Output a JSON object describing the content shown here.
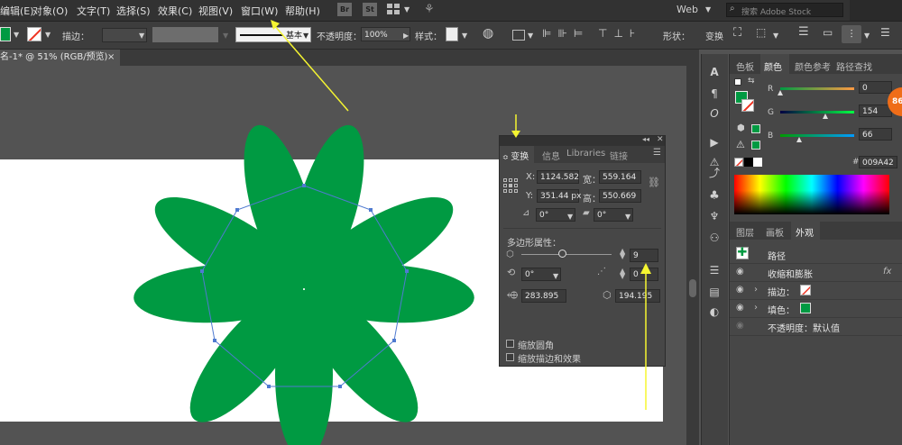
{
  "menubar": {
    "items": [
      "编辑(E)",
      "对象(O)",
      "文字(T)",
      "选择(S)",
      "效果(C)",
      "视图(V)",
      "窗口(W)",
      "帮助(H)"
    ],
    "bridge_labels": [
      "Br",
      "St"
    ],
    "workspace": "Web",
    "search_placeholder": "搜索 Adobe Stock"
  },
  "controlbar": {
    "stroke_label": "描边：",
    "stroke_profile_label": "基本",
    "opacity_label": "不透明度：",
    "opacity_value": "100%",
    "style_label": "样式：",
    "shape_label": "形状：",
    "transform_label": "变换",
    "colors": {
      "fill": "#009A42",
      "stroke_none": "#ffffff"
    }
  },
  "document": {
    "tab_title": "名-1* @ 51% (RGB/预览)",
    "close_glyph": "×"
  },
  "transform_panel": {
    "tabs": [
      "变换",
      "信息",
      "Libraries",
      "链接"
    ],
    "x_label": "X:",
    "x_value": "1124.582",
    "y_label": "Y:",
    "y_value": "351.44 px",
    "w_label": "宽：",
    "w_value": "559.164",
    "h_label": "高：",
    "h_value": "550.669",
    "rotate_value": "0°",
    "shear_value": "0°",
    "polygon_section": "多边形属性：",
    "sides_value": "9",
    "poly_angle_value": "0°",
    "corner_value": "0",
    "radius_value": "283.895",
    "side_length_value": "194.195",
    "sides_slider_fraction": 0.45,
    "scale_corners_label": "缩放圆角",
    "scale_strokes_label": "缩放描边和效果"
  },
  "color_panel": {
    "tabs": [
      "色板",
      "颜色",
      "颜色参考",
      "路径查找"
    ],
    "active_tab": "颜色",
    "r_label": "R",
    "g_label": "G",
    "b_label": "B",
    "r_value": "0",
    "g_value": "154",
    "b_value": "66",
    "r_fraction": 0.0,
    "g_fraction": 0.604,
    "b_fraction": 0.259,
    "hex_label": "#",
    "hex_value": "009A42",
    "accent": "#009A42"
  },
  "appearance_panel": {
    "tabs": [
      "图层",
      "画板",
      "外观"
    ],
    "active_tab": "外观",
    "rows": [
      {
        "label": "路径"
      },
      {
        "label": "收缩和膨胀",
        "fx": "fx"
      },
      {
        "label": "描边："
      },
      {
        "label": "填色："
      },
      {
        "label": "不透明度：默认值"
      }
    ]
  },
  "badge": "86"
}
